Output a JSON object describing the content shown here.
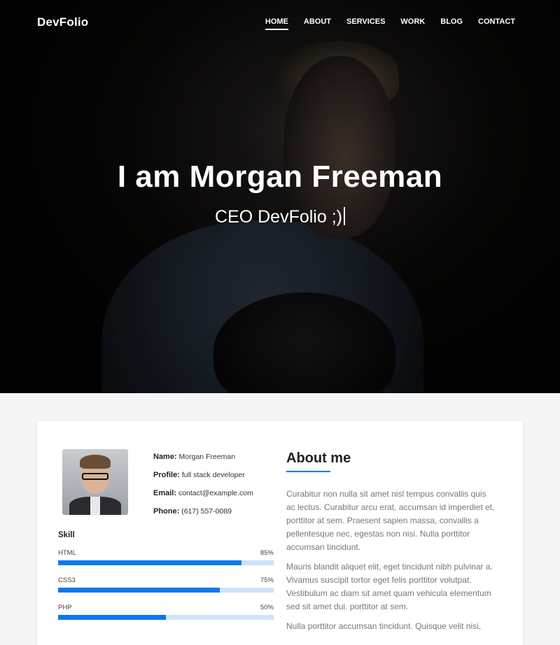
{
  "nav": {
    "brand": "DevFolio",
    "items": [
      {
        "label": "HOME",
        "active": true
      },
      {
        "label": "ABOUT",
        "active": false
      },
      {
        "label": "SERVICES",
        "active": false
      },
      {
        "label": "WORK",
        "active": false
      },
      {
        "label": "BLOG",
        "active": false
      },
      {
        "label": "CONTACT",
        "active": false
      }
    ]
  },
  "hero": {
    "title": "I am Morgan Freeman",
    "subtitle": "CEO DevFolio ;)"
  },
  "profile": {
    "name_label": "Name:",
    "name_value": "Morgan Freeman",
    "profile_label": "Profile:",
    "profile_value": "full stack developer",
    "email_label": "Email:",
    "email_value": "contact@example.com",
    "phone_label": "Phone:",
    "phone_value": "(617) 557-0089"
  },
  "skills": {
    "title": "Skill",
    "items": [
      {
        "name": "HTML",
        "percent_label": "85%",
        "value": 85
      },
      {
        "name": "CSS3",
        "percent_label": "75%",
        "value": 75
      },
      {
        "name": "PHP",
        "percent_label": "50%",
        "value": 50
      }
    ]
  },
  "about": {
    "title": "About me",
    "paragraphs": [
      "Curabitur non nulla sit amet nisl tempus convallis quis ac lectus. Curabitur arcu erat, accumsan id imperdiet et, porttitor at sem. Praesent sapien massa, convallis a pellentesque nec, egestas non nisi. Nulla porttitor accumsan tincidunt.",
      "Mauris blandit aliquet elit, eget tincidunt nibh pulvinar a. Vivamus suscipit tortor eget felis porttitor volutpat. Vestibulum ac diam sit amet quam vehicula elementum sed sit amet dui. porttitor at sem.",
      "Nulla porttitor accumsan tincidunt. Quisque velit nisi,"
    ]
  },
  "colors": {
    "accent": "#0a78f2",
    "track": "#cfe2fa"
  }
}
